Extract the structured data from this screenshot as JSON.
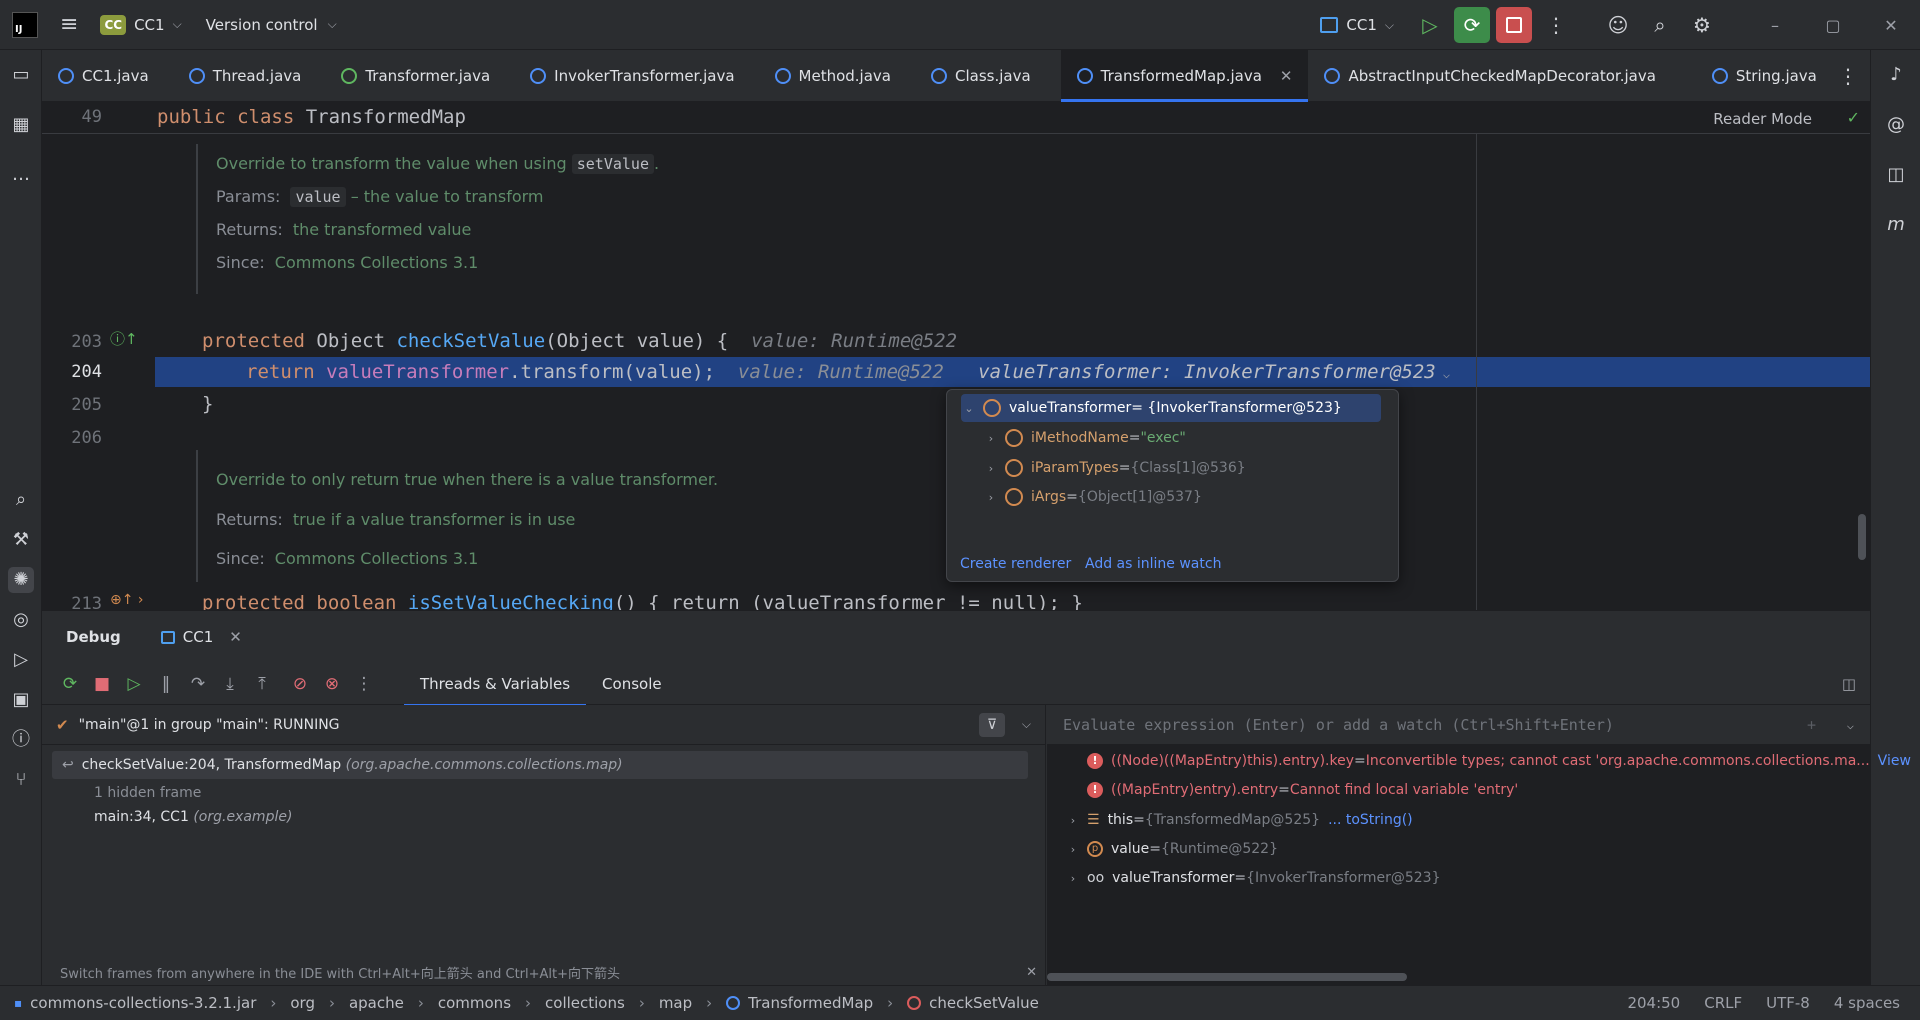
{
  "titlebar": {
    "logo": "IJ",
    "project_badge": "CC",
    "project_name": "CC1",
    "vcs_label": "Version control",
    "run_config": "CC1"
  },
  "tabs": [
    {
      "label": "CC1.java",
      "icon": "class-icon"
    },
    {
      "label": "Thread.java",
      "icon": "class-icon"
    },
    {
      "label": "Transformer.java",
      "icon": "interface-icon"
    },
    {
      "label": "InvokerTransformer.java",
      "icon": "class-icon"
    },
    {
      "label": "Method.java",
      "icon": "class-icon"
    },
    {
      "label": "Class.java",
      "icon": "class-icon"
    },
    {
      "label": "TransformedMap.java",
      "icon": "class-icon",
      "active": true
    },
    {
      "label": "AbstractInputCheckedMapDecorator.java",
      "icon": "class-icon"
    },
    {
      "label": "String.java",
      "icon": "class-icon"
    }
  ],
  "editor": {
    "sticky_line": "49",
    "sticky_text_kw": "public class",
    "sticky_text_name": "TransformedMap",
    "reader_mode": "Reader Mode",
    "doc1": {
      "line1_pre": "Override to transform the value when using",
      "line1_code": "setValue",
      "line1_post": ".",
      "params_label": "Params:",
      "params_code": "value",
      "params_text": "– the value to transform",
      "returns_label": "Returns:",
      "returns_text": "the transformed value",
      "since_label": "Since:",
      "since_text": "Commons Collections 3.1"
    },
    "lines": {
      "l203": "203",
      "l204": "204",
      "l205": "205",
      "l206": "206",
      "l213": "213"
    },
    "code203": {
      "kw": "protected",
      "type": " Object ",
      "fn": "checkSetValue",
      "rest": "(Object value) {",
      "hint": "value: Runtime@522"
    },
    "code204": {
      "kw": "return ",
      "fld": "valueTransformer",
      "rest1": ".transform(value);",
      "hint1": "value: Runtime@522",
      "hint2": "valueTransformer: InvokerTransformer@523"
    },
    "code205": "}",
    "doc2": {
      "line1": "Override to only return true when there is a value transformer.",
      "returns_label": "Returns:",
      "returns_text": "true if a value transformer is in use",
      "since_label": "Since:",
      "since_text": "Commons Collections 3.1"
    },
    "code213": {
      "kw": "protected boolean ",
      "fn": "isSetValueChecking",
      "rest": "() { return (valueTransformer != null); }"
    }
  },
  "popup": {
    "root": {
      "name": "valueTransformer",
      "value": " = {InvokerTransformer@523}"
    },
    "children": [
      {
        "name": "iMethodName",
        "eq": " = ",
        "value": "\"exec\"",
        "kind": "string"
      },
      {
        "name": "iParamTypes",
        "eq": " = ",
        "value": "{Class[1]@536}",
        "kind": "ref"
      },
      {
        "name": "iArgs",
        "eq": " = ",
        "value": "{Object[1]@537}",
        "kind": "ref"
      }
    ],
    "create_renderer": "Create renderer",
    "add_inline_watch": "Add as inline watch"
  },
  "debug": {
    "title": "Debug",
    "session": "CC1",
    "tab_threads": "Threads & Variables",
    "tab_console": "Console",
    "thread_status": "\"main\"@1 in group \"main\": RUNNING",
    "frames": [
      {
        "text": "checkSetValue:204, TransformedMap",
        "pkg": "(org.apache.commons.collections.map)"
      },
      {
        "text": "1 hidden frame",
        "pkg": ""
      },
      {
        "text": "main:34, CC1",
        "pkg": "(org.example)"
      }
    ],
    "frames_hint": "Switch frames from anywhere in the IDE with Ctrl+Alt+向上箭头 and Ctrl+Alt+向下箭头",
    "eval_placeholder": "Evaluate expression (Enter) or add a watch (Ctrl+Shift+Enter)",
    "variables": [
      {
        "name": "((Node)((MapEntry)this).entry).key",
        "eq": " = ",
        "value": "Inconvertible types; cannot cast 'org.apache.commons.collections.ma...",
        "link": "View",
        "kind": "error"
      },
      {
        "name": "((MapEntry)entry).entry",
        "eq": " = ",
        "value": "Cannot find local variable 'entry'",
        "link": "",
        "kind": "error"
      },
      {
        "name": "this",
        "eq": " = ",
        "value": "{TransformedMap@525}",
        "link": "... toString()",
        "kind": "field"
      },
      {
        "name": "value",
        "eq": " = ",
        "value": "{Runtime@522}",
        "link": "",
        "kind": "param"
      },
      {
        "name": "valueTransformer",
        "eq": " = ",
        "value": "{InvokerTransformer@523}",
        "link": "",
        "kind": "watch"
      }
    ]
  },
  "statusbar": {
    "crumbs": [
      "commons-collections-3.2.1.jar",
      "org",
      "apache",
      "commons",
      "collections",
      "map",
      "TransformedMap",
      "checkSetValue"
    ],
    "position": "204:50",
    "line_sep": "CRLF",
    "encoding": "UTF-8",
    "indent": "4 spaces"
  },
  "colors": {
    "accent": "#3574f0",
    "highlight_row": "#214283",
    "keyword": "#cf8e6d",
    "error": "#e06c75"
  }
}
